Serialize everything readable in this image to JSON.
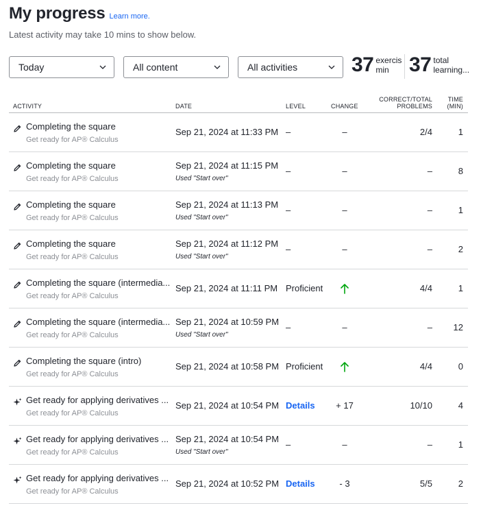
{
  "header": {
    "title": "My progress",
    "learn_more": "Learn more.",
    "subtitle": "Latest activity may take 10 mins to show below."
  },
  "filters": {
    "period": "Today",
    "content": "All content",
    "activities": "All activities"
  },
  "stats": [
    {
      "value": "37",
      "label_line1": "exercis",
      "label_line2": "min"
    },
    {
      "value": "37",
      "label_line1": "total",
      "label_line2": "learning..."
    }
  ],
  "table": {
    "headers": {
      "activity": "ACTIVITY",
      "date": "DATE",
      "level": "LEVEL",
      "change": "CHANGE",
      "correct_line1": "CORRECT/TOTAL",
      "correct_line2": "PROBLEMS",
      "time_line1": "TIME",
      "time_line2": "(MIN)"
    },
    "rows": [
      {
        "icon": "pencil-icon",
        "title": "Completing the square",
        "course": "Get ready for AP® Calculus",
        "date": "Sep 21, 2024 at 11:33 PM",
        "note": "",
        "level": "–",
        "change": "–",
        "correct": "2/4",
        "time": "1"
      },
      {
        "icon": "pencil-icon",
        "title": "Completing the square",
        "course": "Get ready for AP® Calculus",
        "date": "Sep 21, 2024 at 11:15 PM",
        "note": "Used \"Start over\"",
        "level": "–",
        "change": "–",
        "correct": "–",
        "time": "8"
      },
      {
        "icon": "pencil-icon",
        "title": "Completing the square",
        "course": "Get ready for AP® Calculus",
        "date": "Sep 21, 2024 at 11:13 PM",
        "note": "Used \"Start over\"",
        "level": "–",
        "change": "–",
        "correct": "–",
        "time": "1"
      },
      {
        "icon": "pencil-icon",
        "title": "Completing the square",
        "course": "Get ready for AP® Calculus",
        "date": "Sep 21, 2024 at 11:12 PM",
        "note": "Used \"Start over\"",
        "level": "–",
        "change": "–",
        "correct": "–",
        "time": "2"
      },
      {
        "icon": "pencil-icon",
        "title": "Completing the square (intermedia...",
        "course": "Get ready for AP® Calculus",
        "date": "Sep 21, 2024 at 11:11 PM",
        "note": "",
        "level": "Proficient",
        "change": "up-arrow",
        "correct": "4/4",
        "time": "1"
      },
      {
        "icon": "pencil-icon",
        "title": "Completing the square (intermedia...",
        "course": "Get ready for AP® Calculus",
        "date": "Sep 21, 2024 at 10:59 PM",
        "note": "Used \"Start over\"",
        "level": "–",
        "change": "–",
        "correct": "–",
        "time": "12"
      },
      {
        "icon": "pencil-icon",
        "title": "Completing the square (intro)",
        "course": "Get ready for AP® Calculus",
        "date": "Sep 21, 2024 at 10:58 PM",
        "note": "",
        "level": "Proficient",
        "change": "up-arrow",
        "correct": "4/4",
        "time": "0"
      },
      {
        "icon": "sparkle-icon",
        "title": "Get ready for applying derivatives ...",
        "course": "Get ready for AP® Calculus",
        "date": "Sep 21, 2024 at 10:54 PM",
        "note": "",
        "level": "Details",
        "change": "+ 17",
        "correct": "10/10",
        "time": "4"
      },
      {
        "icon": "sparkle-icon",
        "title": "Get ready for applying derivatives ...",
        "course": "Get ready for AP® Calculus",
        "date": "Sep 21, 2024 at 10:54 PM",
        "note": "Used \"Start over\"",
        "level": "–",
        "change": "–",
        "correct": "–",
        "time": "1"
      },
      {
        "icon": "sparkle-icon",
        "title": "Get ready for applying derivatives ...",
        "course": "Get ready for AP® Calculus",
        "date": "Sep 21, 2024 at 10:52 PM",
        "note": "",
        "level": "Details",
        "change": "- 3",
        "correct": "5/5",
        "time": "2"
      }
    ]
  },
  "colors": {
    "link": "#1865f2",
    "up_arrow": "#00a60e",
    "muted": "#8c8f95"
  }
}
